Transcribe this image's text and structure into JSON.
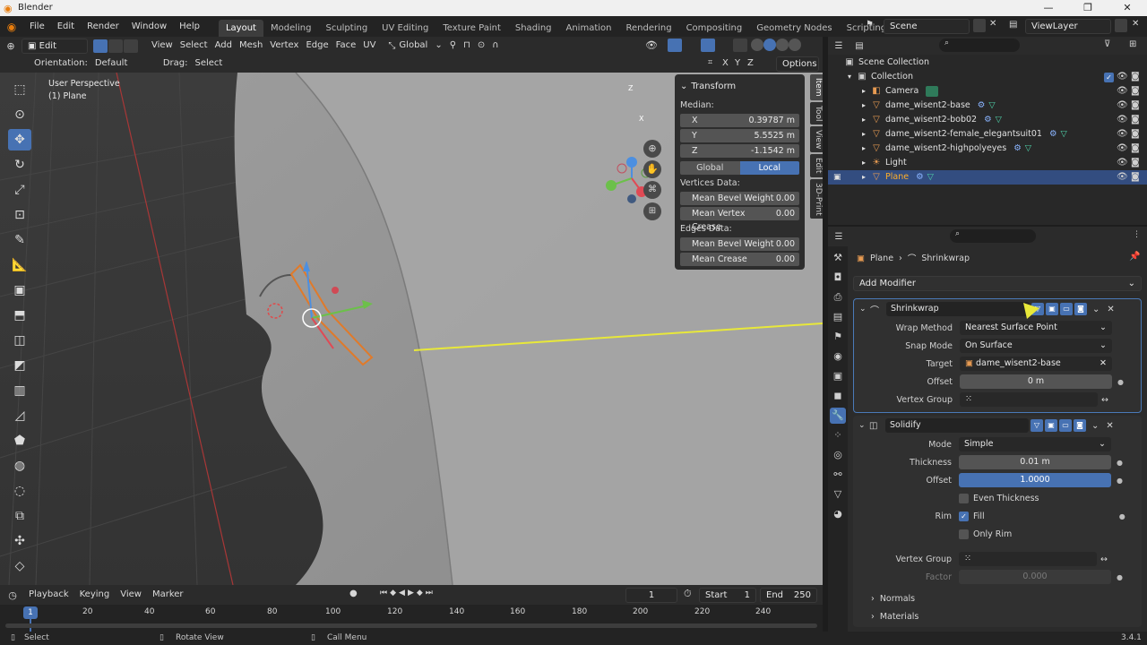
{
  "window": {
    "title": "Blender",
    "controls": [
      "—",
      "❐",
      "✕"
    ]
  },
  "menu": [
    "File",
    "Edit",
    "Render",
    "Window",
    "Help"
  ],
  "workspaces": [
    "Layout",
    "Modeling",
    "Sculpting",
    "UV Editing",
    "Texture Paint",
    "Shading",
    "Animation",
    "Rendering",
    "Compositing",
    "Geometry Nodes",
    "Scripting"
  ],
  "workspace_active": "Layout",
  "add_tab": "+",
  "scene": "Scene",
  "view_layer": "ViewLayer",
  "viewport_header": {
    "mode": "Edit Mode",
    "menus": [
      "View",
      "Select",
      "Add",
      "Mesh",
      "Vertex",
      "Edge",
      "Face",
      "UV"
    ],
    "transform_orientation": "Global"
  },
  "tool_header": {
    "orientation_label": "Orientation:",
    "orientation_value": "Default",
    "drag_label": "Drag:",
    "drag_value": "Select Box",
    "axes": [
      "X",
      "Y",
      "Z"
    ],
    "options": "Options"
  },
  "viewport": {
    "perspective": "User Perspective",
    "object": "(1) Plane",
    "gizmo": {
      "x": "X",
      "y": "Y",
      "z": "Z"
    }
  },
  "transform_panel": {
    "title": "Transform",
    "median_label": "Median:",
    "x": {
      "label": "X",
      "value": "0.39787 m"
    },
    "y": {
      "label": "Y",
      "value": "5.5525 m"
    },
    "z": {
      "label": "Z",
      "value": "-1.1542 m"
    },
    "global": "Global",
    "local": "Local",
    "vertices_label": "Vertices Data:",
    "mean_bevel_weight": {
      "label": "Mean Bevel Weight",
      "value": "0.00"
    },
    "mean_vertex_crease": {
      "label": "Mean Vertex Crease",
      "value": "0.00"
    },
    "edges_label": "Edges Data:",
    "edge_bevel_weight": {
      "label": "Mean Bevel Weight",
      "value": "0.00"
    },
    "mean_crease": {
      "label": "Mean Crease",
      "value": "0.00"
    }
  },
  "side_tabs": [
    "Item",
    "Tool",
    "View",
    "Edit",
    "3D-Print"
  ],
  "timeline": {
    "menus": [
      "Playback",
      "Keying",
      "View",
      "Marker"
    ],
    "current_frame": "1",
    "start_label": "Start",
    "start": "1",
    "end_label": "End",
    "end": "250",
    "ticks": [
      "20",
      "40",
      "60",
      "80",
      "100",
      "120",
      "140",
      "160",
      "180",
      "200",
      "220",
      "240"
    ],
    "playhead": "1"
  },
  "statusbar": {
    "select": "Select",
    "rotate": "Rotate View",
    "call_menu": "Call Menu",
    "version": "3.4.1"
  },
  "outliner": {
    "root": "Scene Collection",
    "collection": "Collection",
    "items": [
      {
        "name": "Camera",
        "icon": "camera-icon"
      },
      {
        "name": "dame_wisent2-base",
        "icon": "mesh-icon"
      },
      {
        "name": "dame_wisent2-bob02",
        "icon": "mesh-icon"
      },
      {
        "name": "dame_wisent2-female_elegantsuit01",
        "icon": "mesh-icon"
      },
      {
        "name": "dame_wisent2-highpolyeyes",
        "icon": "mesh-icon"
      },
      {
        "name": "Light",
        "icon": "light-icon"
      },
      {
        "name": "Plane",
        "icon": "mesh-icon",
        "selected": true
      }
    ]
  },
  "properties": {
    "breadcrumb_object": "Plane",
    "breadcrumb_modifier": "Shrinkwrap",
    "add_modifier": "Add Modifier",
    "shrinkwrap": {
      "name": "Shrinkwrap",
      "wrap_method_label": "Wrap Method",
      "wrap_method": "Nearest Surface Point",
      "snap_mode_label": "Snap Mode",
      "snap_mode": "On Surface",
      "target_label": "Target",
      "target": "dame_wisent2-base",
      "offset_label": "Offset",
      "offset": "0 m",
      "vertex_group_label": "Vertex Group"
    },
    "solidify": {
      "name": "Solidify",
      "mode_label": "Mode",
      "mode": "Simple",
      "thickness_label": "Thickness",
      "thickness": "0.01 m",
      "offset_label": "Offset",
      "offset": "1.0000",
      "even_thickness": "Even Thickness",
      "rim_label": "Rim",
      "fill": "Fill",
      "only_rim": "Only Rim",
      "vertex_group_label": "Vertex Group",
      "factor_label": "Factor",
      "factor": "0.000"
    },
    "normals": "Normals",
    "materials": "Materials"
  },
  "colors": {
    "accent": "#4772b3",
    "selection": "#334d80",
    "annotation": "#e8e83a"
  }
}
